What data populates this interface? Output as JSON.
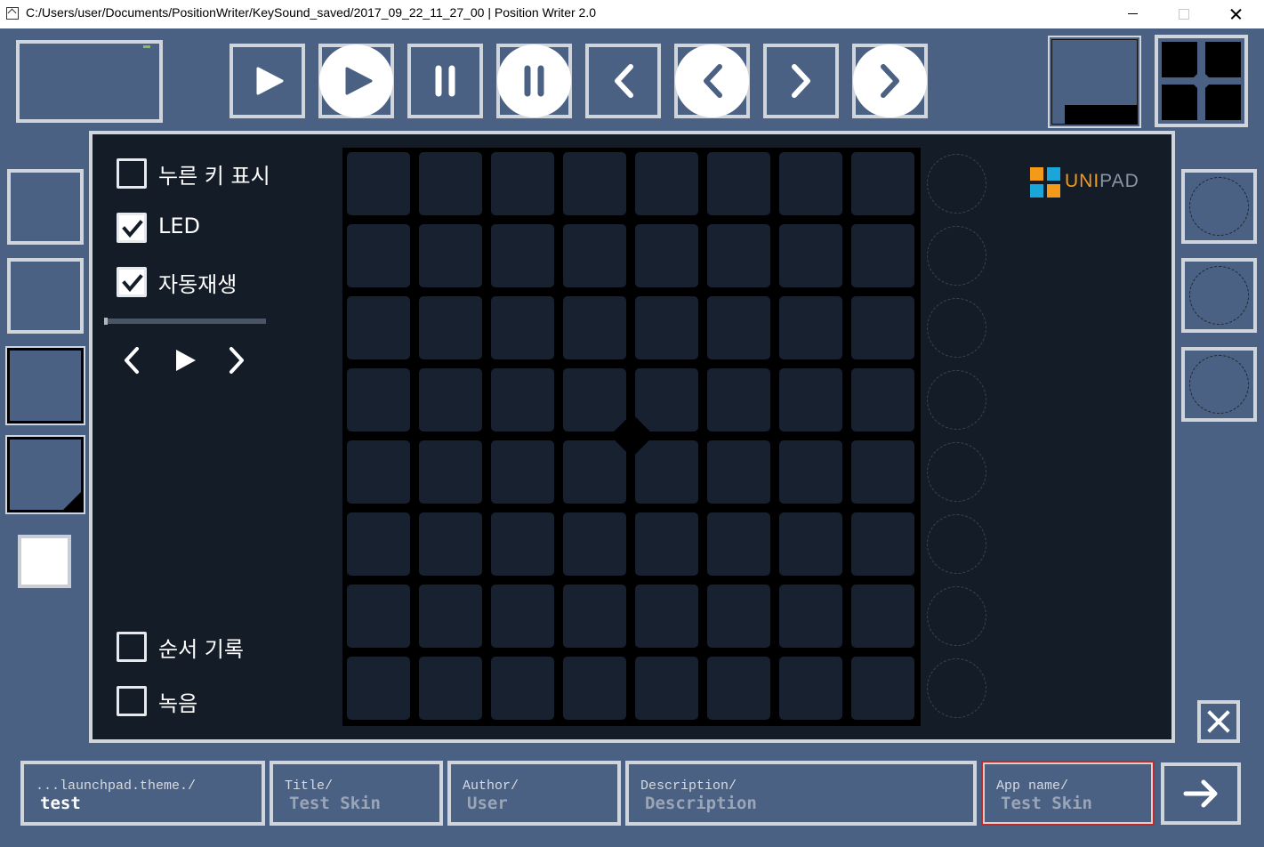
{
  "window": {
    "title": "C:/Users/user/Documents/PositionWriter/KeySound_saved/2017_09_22_11_27_00 | Position Writer 2.0"
  },
  "toolbar": {
    "buttons": [
      {
        "name": "play",
        "icon": "play-icon",
        "round": false
      },
      {
        "name": "play-round",
        "icon": "play-icon",
        "round": true
      },
      {
        "name": "pause",
        "icon": "pause-icon",
        "round": false
      },
      {
        "name": "pause-round",
        "icon": "pause-icon",
        "round": true
      },
      {
        "name": "prev",
        "icon": "chevron-left-icon",
        "round": false
      },
      {
        "name": "prev-round",
        "icon": "chevron-left-icon",
        "round": true
      },
      {
        "name": "next",
        "icon": "chevron-right-icon",
        "round": false
      },
      {
        "name": "next-round",
        "icon": "chevron-right-icon",
        "round": true
      }
    ]
  },
  "options": {
    "show_pressed_keys": {
      "label": "누른 키 표시",
      "checked": false
    },
    "led": {
      "label": "LED",
      "checked": true
    },
    "autoplay": {
      "label": "자동재생",
      "checked": true
    },
    "record_order": {
      "label": "순서 기록",
      "checked": false
    },
    "recording": {
      "label": "녹음",
      "checked": false
    },
    "autoplay_progress": 0
  },
  "logo": {
    "part1": "UNI",
    "part2": "PAD",
    "colors": [
      "#f39a1b",
      "#1aa6d9"
    ]
  },
  "grid": {
    "rows": 8,
    "cols": 8,
    "round_pads": 8
  },
  "fields": {
    "path": {
      "label": "...launchpad.theme./",
      "value": "test"
    },
    "title": {
      "label": "Title/",
      "value": "Test Skin"
    },
    "author": {
      "label": "Author/",
      "value": "User"
    },
    "description": {
      "label": "Description/",
      "value": "Description"
    },
    "app_name": {
      "label": "App name/",
      "value": "Test Skin"
    }
  },
  "colors": {
    "background": "#4b6184",
    "panel": "#141c27",
    "pad": "#182130",
    "accent_red": "#c02a2a"
  }
}
